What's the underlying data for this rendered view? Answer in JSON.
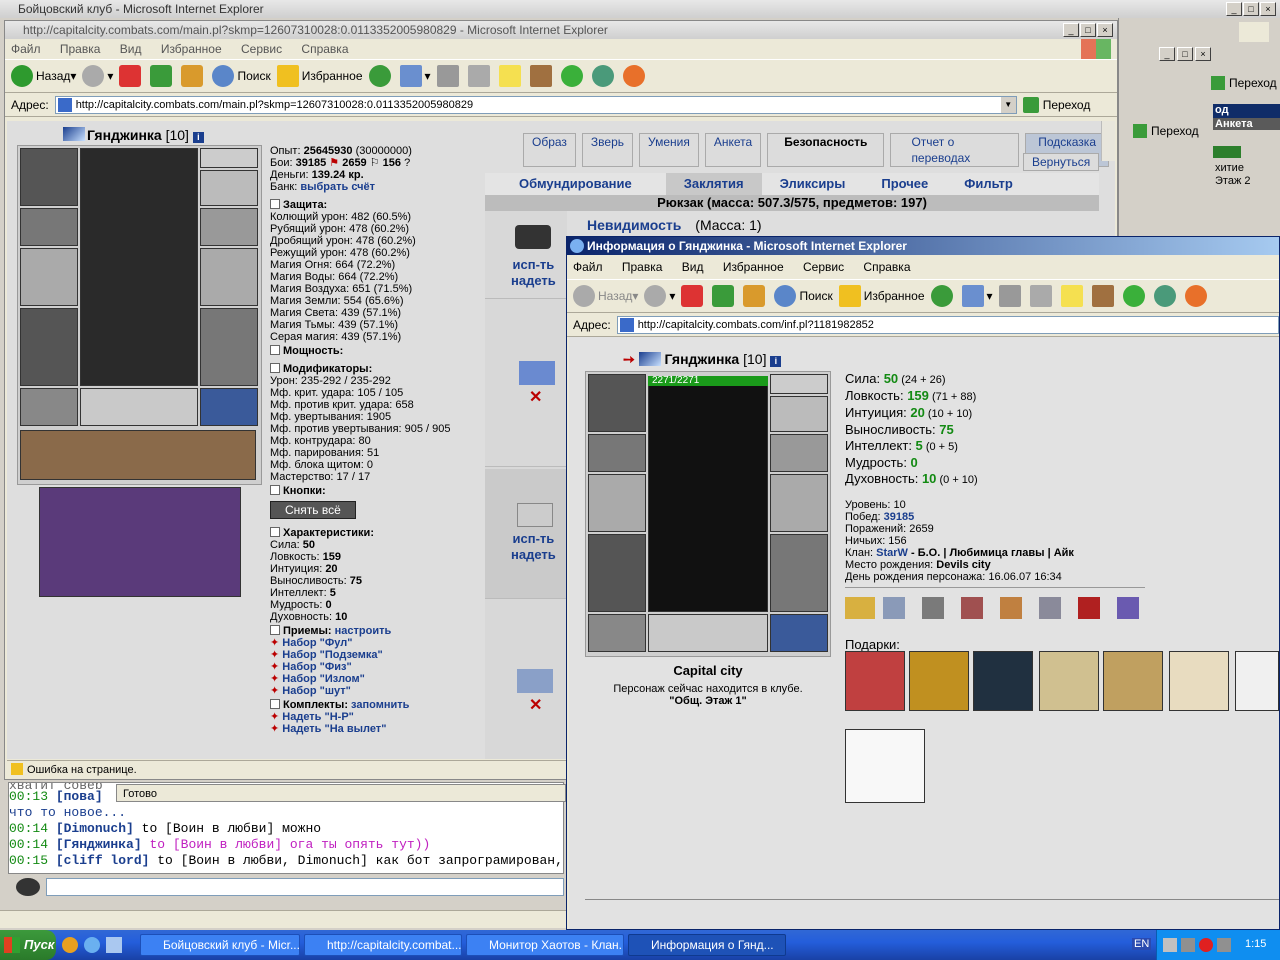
{
  "main_window": {
    "title": "Бойцовский клуб - Microsoft Internet Explorer",
    "menu": [
      "Файл",
      "Правка",
      "Вид",
      "Избранное",
      "Сервис",
      "Справка"
    ],
    "toolbar": {
      "back": "Назад",
      "search": "Поиск",
      "favorites": "Избранное"
    },
    "address_label": "Адрес:",
    "go_label": "Переход",
    "status": "Ошибка на странице."
  },
  "inner_window": {
    "title": "http://capitalcity.combats.com/main.pl?skmp=12607310028:0.0113352005980829 - Microsoft Internet Explorer",
    "address": "http://capitalcity.combats.com/main.pl?skmp=12607310028:0.0113352005980829",
    "status": "Готово"
  },
  "bg_right": {
    "go_label": "Переход",
    "anketa": "Анкета",
    "text1": "хитие",
    "text2": "Этаж 2",
    "prefix": "од"
  },
  "character": {
    "name": "Гянджинка",
    "level": "[10]",
    "exp_label": "Опыт:",
    "exp": "25645930",
    "exp_next": "(30000000)",
    "fights_label": "Бои:",
    "wins": "39185",
    "losses": "2659",
    "draws": "156",
    "money_label": "Деньги:",
    "money": "139.24 кр.",
    "bank_label": "Банк:",
    "bank_link": "выбрать счёт",
    "defense_title": "Защита:",
    "defense": [
      "Колющий урон: 482 (60.5%)",
      "Рубящий урон: 478 (60.2%)",
      "Дробящий урон: 478 (60.2%)",
      "Режущий урон: 478 (60.2%)",
      "Магия Огня: 664 (72.2%)",
      "Магия Воды: 664 (72.2%)",
      "Магия Воздуха: 651 (71.5%)",
      "Магия Земли: 554 (65.6%)",
      "Магия Света: 439 (57.1%)",
      "Магия Тьмы: 439 (57.1%)",
      "Серая магия: 439 (57.1%)"
    ],
    "power_title": "Мощность:",
    "mods_title": "Модификаторы:",
    "mods": [
      "Урон: 235-292 / 235-292",
      "Мф. крит. удара: 105 / 105",
      "Мф. против крит. удара: 658",
      "Мф. увертывания: 1905",
      "Мф. против увертывания: 905 / 905",
      "Мф. контрудара: 80",
      "Мф. парирования: 51",
      "Мф. блока щитом: 0",
      "Мастерство: 17 / 17"
    ],
    "buttons_title": "Кнопки:",
    "remove_all": "Снять всё",
    "chars_title": "Характеристики:",
    "chars": [
      "Сила: 50",
      "Ловкость: 159",
      "Интуиция: 20",
      "Выносливость: 75",
      "Интеллект: 5",
      "Мудрость: 0",
      "Духовность: 10"
    ],
    "tricks_title": "Приемы:",
    "tricks_link": "настроить",
    "tricks": [
      "Набор \"Фул\"",
      "Набор \"Подземка\"",
      "Набор \"Физ\"",
      "Набор \"Излом\"",
      "Набор \"шут\""
    ],
    "sets_title": "Комплекты:",
    "sets_link": "запомнить",
    "sets": [
      "Надеть \"Н-Р\"",
      "Надеть \"На вылет\""
    ]
  },
  "top_buttons": [
    "Образ",
    "Зверь",
    "Умения",
    "Анкета",
    "Безопасность",
    "Отчет о переводах",
    "Подсказка"
  ],
  "back_button": "Вернуться",
  "inv_tabs": [
    "Обмундирование",
    "Заклятия",
    "Эликсиры",
    "Прочее",
    "Фильтр"
  ],
  "backpack": "Рюкзак (масса: 507.3/575, предметов: 197)",
  "item1": {
    "name": "Невидимость",
    "mass": "(Масса: 1)"
  },
  "use_label": "исп-ть",
  "wear_label": "надеть",
  "chat": [
    {
      "time": "00:13",
      "nick": "пова",
      "text": ""
    },
    {
      "time": "",
      "nick": "",
      "text": "что то новое..."
    },
    {
      "time": "00:14",
      "nick": "Dimonuch",
      "text": "to [Воин в любви] можно"
    },
    {
      "time": "00:14",
      "nick": "Гянджинка",
      "text": "to [Воин в любви] ога ты опять тут))"
    },
    {
      "time": "00:15",
      "nick": "cliff lord",
      "text": "to [Воин в любви, Dimonuch] как бот запрограмирован, так он"
    }
  ],
  "chat_top_partial": "хватит совер",
  "info_window": {
    "title": "Информация о Гянджинка - Microsoft Internet Explorer",
    "menu": [
      "Файл",
      "Правка",
      "Вид",
      "Избранное",
      "Сервис",
      "Справка"
    ],
    "toolbar": {
      "back": "Назад",
      "search": "Поиск",
      "favorites": "Избранное"
    },
    "address_label": "Адрес:",
    "address": "http://capitalcity.combats.com/inf.pl?1181982852",
    "hp": "2271/2271",
    "stats": [
      {
        "label": "Сила:",
        "value": "50",
        "extra": "(24 + 26)"
      },
      {
        "label": "Ловкость:",
        "value": "159",
        "extra": "(71 + 88)"
      },
      {
        "label": "Интуиция:",
        "value": "20",
        "extra": "(10 + 10)"
      },
      {
        "label": "Выносливость:",
        "value": "75",
        "extra": ""
      },
      {
        "label": "Интеллект:",
        "value": "5",
        "extra": "(0 + 5)"
      },
      {
        "label": "Мудрость:",
        "value": "0",
        "extra": ""
      },
      {
        "label": "Духовность:",
        "value": "10",
        "extra": "(0 + 10)"
      }
    ],
    "level": "Уровень: 10",
    "wins_label": "Побед:",
    "wins": "39185",
    "losses": "Поражений: 2659",
    "draws": "Ничьих: 156",
    "clan_label": "Клан:",
    "clan": "StarW",
    "clan_rest": "- Б.О. | Любимица главы | Айк",
    "birth_place_label": "Место рождения:",
    "birth_place": "Devils city",
    "birthday": "День рождения персонажа: 16.06.07 16:34",
    "gifts_label": "Подарки:",
    "city": "Capital city",
    "location": "Персонаж сейчас находится в клубе.",
    "room": "\"Общ. Этаж 1\""
  },
  "taskbar": {
    "start": "Пуск",
    "items": [
      "Бойцовский клуб - Micr...",
      "http://capitalcity.combat...",
      "Монитор Хаотов - Клан...",
      "Информация о Гянд..."
    ],
    "lang": "EN",
    "clock": "1:15"
  }
}
